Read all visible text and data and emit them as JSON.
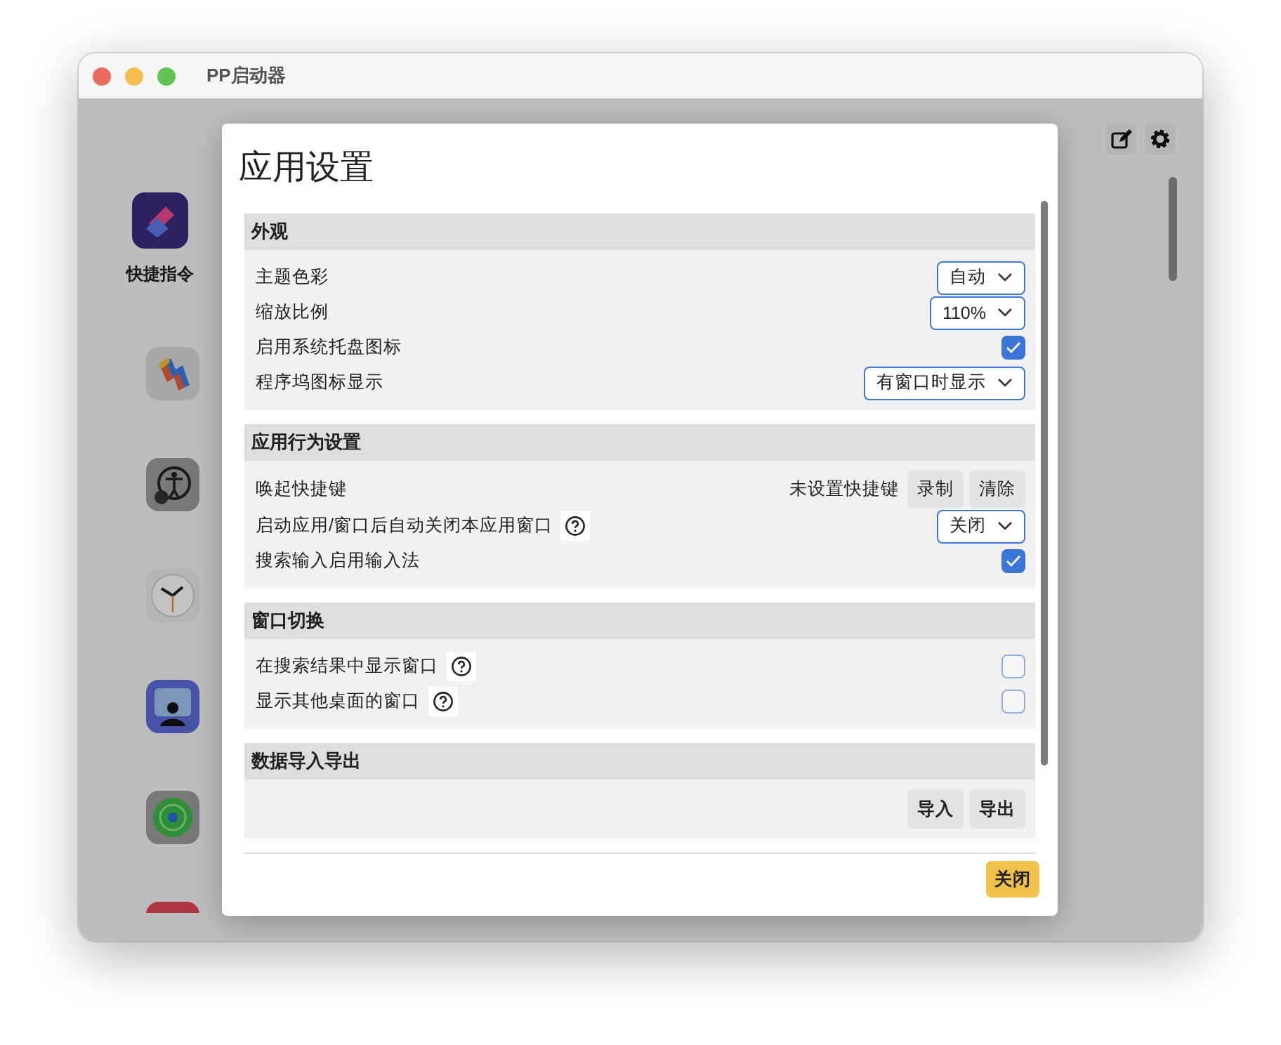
{
  "window": {
    "title": "PP启动器"
  },
  "launcher": {
    "items": [
      {
        "label": "快捷指令"
      }
    ]
  },
  "dialog": {
    "title": "应用设置",
    "sections": [
      {
        "title": "外观",
        "rows": [
          {
            "kind": "select",
            "label": "主题色彩",
            "help": false,
            "value": "自动"
          },
          {
            "kind": "select",
            "label": "缩放比例",
            "help": false,
            "value": "110%"
          },
          {
            "kind": "checkbox",
            "label": "启用系统托盘图标",
            "help": false,
            "checked": true
          },
          {
            "kind": "select",
            "label": "程序坞图标显示",
            "help": false,
            "value": "有窗口时显示"
          }
        ]
      },
      {
        "title": "应用行为设置",
        "rows": [
          {
            "kind": "shortcut",
            "label": "唤起快捷键",
            "help": false,
            "status": "未设置快捷键",
            "buttons": [
              "录制",
              "清除"
            ]
          },
          {
            "kind": "select",
            "label": "启动应用/窗口后自动关闭本应用窗口",
            "help": true,
            "value": "关闭"
          },
          {
            "kind": "checkbox",
            "label": "搜索输入启用输入法",
            "help": false,
            "checked": true
          }
        ]
      },
      {
        "title": "窗口切换",
        "rows": [
          {
            "kind": "checkbox",
            "label": "在搜索结果中显示窗口",
            "help": true,
            "checked": false
          },
          {
            "kind": "checkbox",
            "label": "显示其他桌面的窗口",
            "help": true,
            "checked": false
          }
        ]
      },
      {
        "title": "数据导入导出",
        "rows": [
          {
            "kind": "buttons",
            "buttons": [
              "导入",
              "导出"
            ]
          }
        ]
      }
    ],
    "close_button": "关闭"
  }
}
